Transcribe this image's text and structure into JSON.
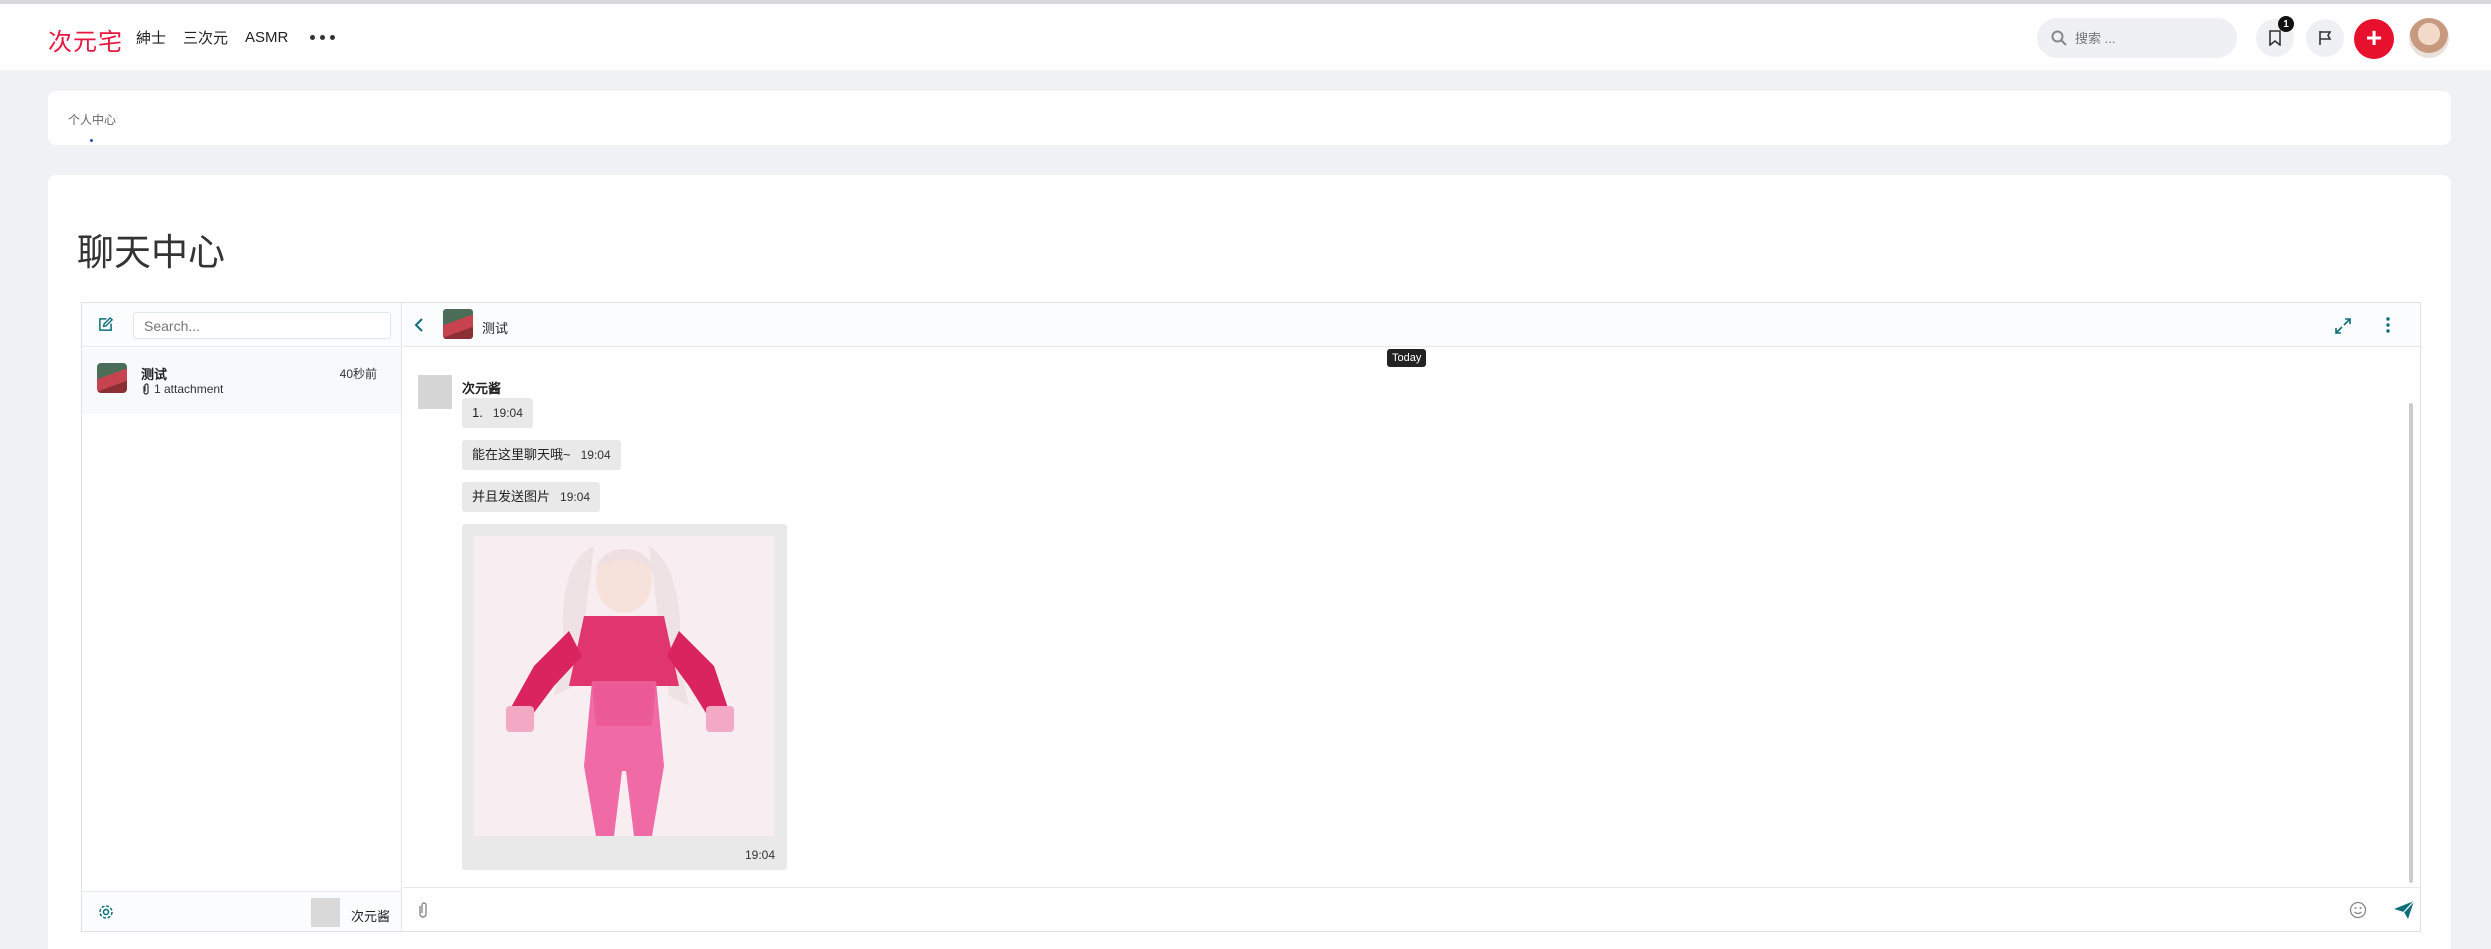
{
  "header": {
    "logo": "次元宅",
    "nav": [
      "紳士",
      "三次元",
      "ASMR"
    ],
    "search_placeholder": "搜索 ...",
    "bookmark_badge": "1"
  },
  "breadcrumb": {
    "label": "个人中心"
  },
  "page": {
    "title": "聊天中心"
  },
  "sidebar": {
    "search_placeholder": "Search...",
    "conversations": [
      {
        "name": "测试",
        "time": "40秒前",
        "preview": "1 attachment"
      }
    ],
    "current_user": "次元酱"
  },
  "conversation": {
    "title": "测试",
    "date_divider": "Today",
    "sender": "次元酱",
    "messages": [
      {
        "text": "1.",
        "time": "19:04"
      },
      {
        "text": "能在这里聊天哦~",
        "time": "19:04"
      },
      {
        "text": "并且发送图片",
        "time": "19:04"
      }
    ],
    "image_time": "19:04"
  },
  "colors": {
    "brand": "#e6173e",
    "accent": "#0d6e7a",
    "plus_button": "#e8112d"
  }
}
